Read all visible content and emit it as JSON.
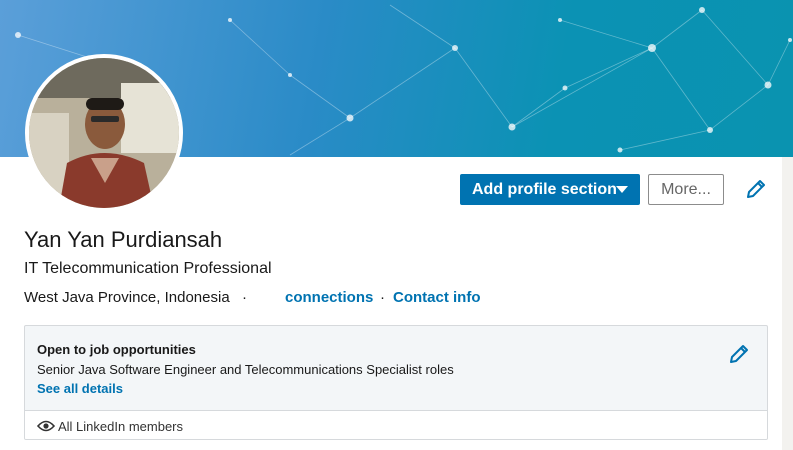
{
  "profile": {
    "name": "Yan Yan Purdiansah",
    "headline": "IT Telecommunication Professional",
    "location": "West Java Province, Indonesia",
    "separator1": "·",
    "connections_label": "connections",
    "separator2": "·",
    "contact_info_label": "Contact info"
  },
  "actions": {
    "add_section_label": "Add profile section",
    "more_label": "More...",
    "edit_icon": "pencil-icon"
  },
  "open_to_jobs": {
    "title": "Open to job opportunities",
    "roles": "Senior Java Software Engineer and Telecommunications Specialist roles",
    "see_all_label": "See all details",
    "visibility_icon": "eye-icon",
    "visibility_label": "All LinkedIn members"
  },
  "colors": {
    "accent": "#0073b1",
    "banner": "#0a93b0",
    "panel_bg": "#f3f6f8"
  }
}
